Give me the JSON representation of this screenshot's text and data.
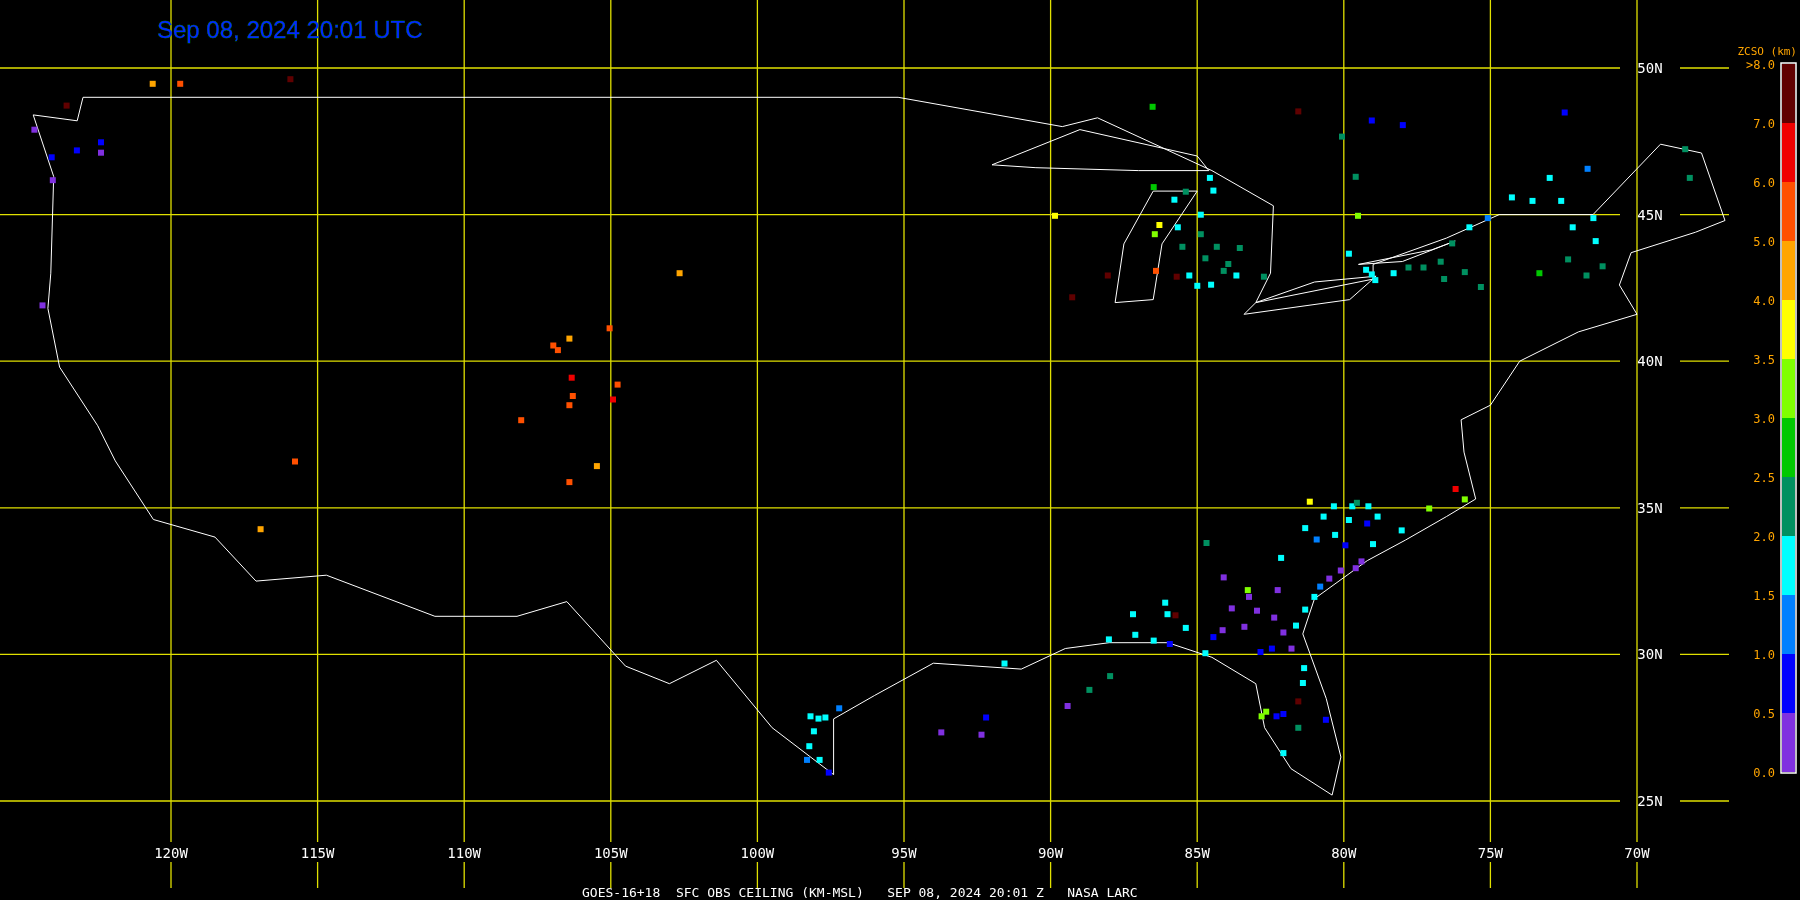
{
  "title": "Sep 08, 2024 20:01 UTC",
  "map": {
    "latitude_labels": [
      "50N",
      "45N",
      "40N",
      "35N",
      "30N",
      "25N"
    ],
    "longitude_labels": [
      "120W",
      "115W",
      "110W",
      "105W",
      "100W",
      "95W",
      "90W",
      "85W",
      "80W",
      "75W",
      "70W"
    ]
  },
  "legend": {
    "title": "ZCSO (km)",
    "tick_labels": [
      ">8.0",
      "7.0",
      "6.0",
      "5.0",
      "4.0",
      "3.5",
      "3.0",
      "2.5",
      "2.0",
      "1.5",
      "1.0",
      "0.5",
      "0.0"
    ],
    "bins": [
      {
        "color": "#600000"
      },
      {
        "color": "#f00000"
      },
      {
        "color": "#ff5000"
      },
      {
        "color": "#ffa500"
      },
      {
        "color": "#ffff00"
      },
      {
        "color": "#80ff00"
      },
      {
        "color": "#00c800"
      },
      {
        "color": "#009060"
      },
      {
        "color": "#00ffff"
      },
      {
        "color": "#0080ff"
      },
      {
        "color": "#0000ff"
      },
      {
        "color": "#8030e0"
      }
    ]
  },
  "caption": "GOES-16+18  SFC OBS CEILING (KM-MSL)   SEP 08, 2024 20:01 Z   NASA LARC"
}
